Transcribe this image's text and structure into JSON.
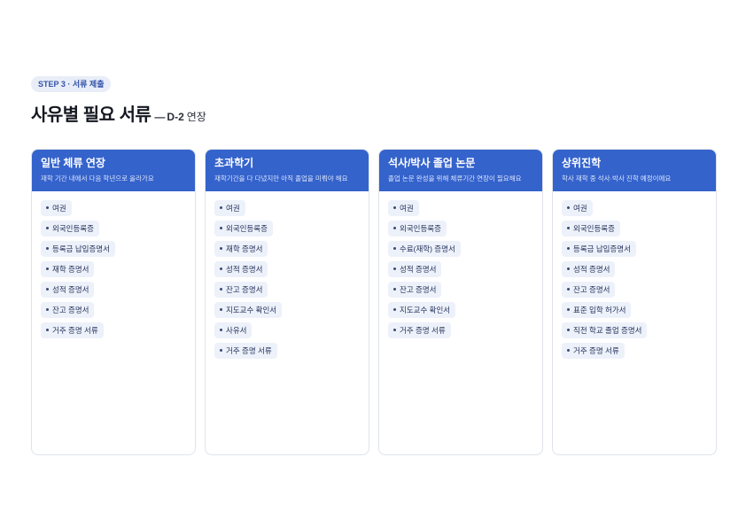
{
  "step_badge": "STEP 3 · 서류 제출",
  "title": {
    "main": "사유별 필요 서류",
    "dash": "—",
    "code": "D-2",
    "suffix": "연장"
  },
  "colors": {
    "accent": "#3563cc",
    "chip_bg": "#edf1fa",
    "badge_bg": "#e8edf8"
  },
  "cards": [
    {
      "title": "일반 체류 연장",
      "subtitle": "재학 기간 내에서 다음 학년으로 올라가요",
      "items": [
        "여권",
        "외국인등록증",
        "등록금 납입증명서",
        "재학 증명서",
        "성적 증명서",
        "잔고 증명서",
        "거주 증명 서류"
      ]
    },
    {
      "title": "초과학기",
      "subtitle": "재학기간을 다 다녔지만 아직 졸업을 미뤄야 해요",
      "items": [
        "여권",
        "외국인등록증",
        "재학 증명서",
        "성적 증명서",
        "잔고 증명서",
        "지도교수 확인서",
        "사유서",
        "거주 증명 서류"
      ]
    },
    {
      "title": "석사/박사 졸업 논문",
      "subtitle": "졸업 논문 완성을 위해 체류기간 연장이 필요해요",
      "items": [
        "여권",
        "외국인등록증",
        "수료(재학) 증명서",
        "성적 증명서",
        "잔고 증명서",
        "지도교수 확인서",
        "거주 증명 서류"
      ]
    },
    {
      "title": "상위진학",
      "subtitle": "학사 재학 중 석사·박사 진학 예정이에요",
      "items": [
        "여권",
        "외국인등록증",
        "등록금 납입증명서",
        "성적 증명서",
        "잔고 증명서",
        "표준 입학 허가서",
        "직전 학교 졸업 증명서",
        "거주 증명 서류"
      ]
    }
  ]
}
